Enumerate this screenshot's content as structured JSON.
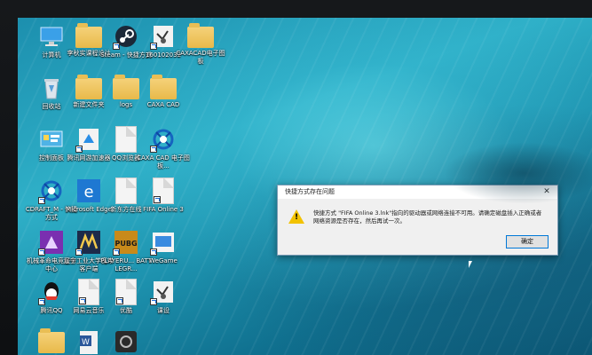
{
  "desktop": {
    "icons": [
      {
        "label": "计算机",
        "icon": "computer-icon"
      },
      {
        "label": "李秋实课程设计",
        "icon": "folder-icon"
      },
      {
        "label": "Steam - 快捷方式",
        "icon": "steam-icon"
      },
      {
        "label": "160102032",
        "icon": "file-icon"
      },
      {
        "label": "CAXACAD电子图板",
        "icon": "folder-icon"
      },
      {
        "label": "回收站",
        "icon": "recycle-bin-icon"
      },
      {
        "label": "新建文件夹",
        "icon": "folder-icon"
      },
      {
        "label": "logs",
        "icon": "folder-icon"
      },
      {
        "label": "CAXA CAD",
        "icon": "folder-icon"
      },
      {
        "label": "控制面板",
        "icon": "control-panel-icon"
      },
      {
        "label": "腾讯网游加速器",
        "icon": "accelerator-icon"
      },
      {
        "label": "QQ浏览器",
        "icon": "document-icon"
      },
      {
        "label": "CAXA CAD 电子图板...",
        "icon": "caxa-icon"
      },
      {
        "label": "CDRAFT_M - 快捷方式",
        "icon": "caxa-icon"
      },
      {
        "label": "Microsoft Edge",
        "icon": "edge-icon"
      },
      {
        "label": "新东方在线",
        "icon": "document-icon"
      },
      {
        "label": "FIFA Online 3",
        "icon": "fifa-icon"
      },
      {
        "label": "机械革命电竞服务中心",
        "icon": "mechrevo-icon"
      },
      {
        "label": "辽宁工业大学宽带客户端",
        "icon": "university-icon"
      },
      {
        "label": "PLAYERU... BATTLEGR...",
        "icon": "pubg-icon"
      },
      {
        "label": "WeGame",
        "icon": "wegame-icon"
      },
      {
        "label": "腾讯QQ",
        "icon": "qq-icon"
      },
      {
        "label": "网易云音乐",
        "icon": "document-icon"
      },
      {
        "label": "优酷",
        "icon": "document-icon"
      },
      {
        "label": "课设",
        "icon": "file-icon"
      },
      {
        "label": "",
        "icon": "folder-icon"
      },
      {
        "label": "",
        "icon": "word-icon"
      },
      {
        "label": "",
        "icon": "app-icon"
      }
    ]
  },
  "dialog": {
    "title": "快捷方式存在问题",
    "message": "快捷方式 \"FIFA Online 3.lnk\"指向的驱动器或网络连接不可用。请确定磁盘插入正确或者网络资源是否存在，然后再试一次。",
    "ok_label": "确定",
    "close_glyph": "✕"
  }
}
